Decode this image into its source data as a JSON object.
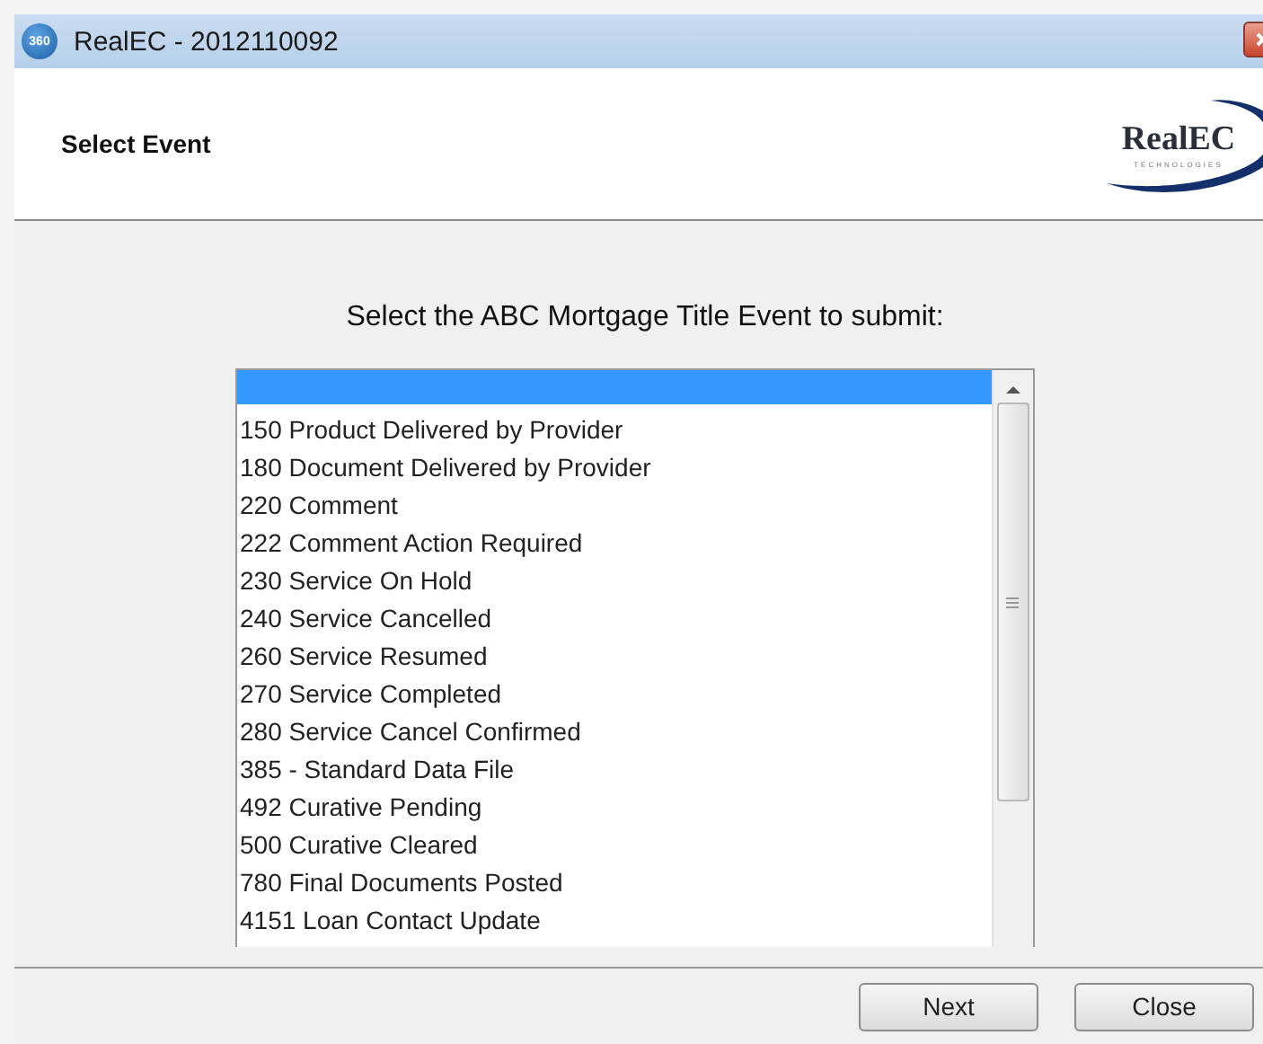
{
  "window": {
    "title": "RealEC - 2012110092",
    "app_badge": "360"
  },
  "header": {
    "title": "Select Event",
    "logo": {
      "name": "RealEC",
      "tagline": "TECHNOLOGIES"
    }
  },
  "prompt": "Select the ABC Mortgage Title Event to submit:",
  "list": {
    "blank_row_selected": true,
    "items": [
      {
        "label": "150 Product Delivered by Provider",
        "selected": false
      },
      {
        "label": "180 Document Delivered by Provider",
        "selected": false
      },
      {
        "label": "220 Comment",
        "selected": false
      },
      {
        "label": "222 Comment Action Required",
        "selected": false
      },
      {
        "label": "230 Service On Hold",
        "selected": false
      },
      {
        "label": "240 Service Cancelled",
        "selected": false
      },
      {
        "label": "260 Service Resumed",
        "selected": false
      },
      {
        "label": "270 Service Completed",
        "selected": false
      },
      {
        "label": "280 Service Cancel Confirmed",
        "selected": false
      },
      {
        "label": "385 - Standard Data File",
        "selected": false
      },
      {
        "label": "492 Curative Pending",
        "selected": false
      },
      {
        "label": "500 Curative Cleared",
        "selected": false
      },
      {
        "label": "780 Final Documents Posted",
        "selected": false
      },
      {
        "label": "4151 Loan Contact Update",
        "selected": false
      }
    ]
  },
  "buttons": [
    {
      "label": "Next"
    },
    {
      "label": "Close"
    }
  ]
}
